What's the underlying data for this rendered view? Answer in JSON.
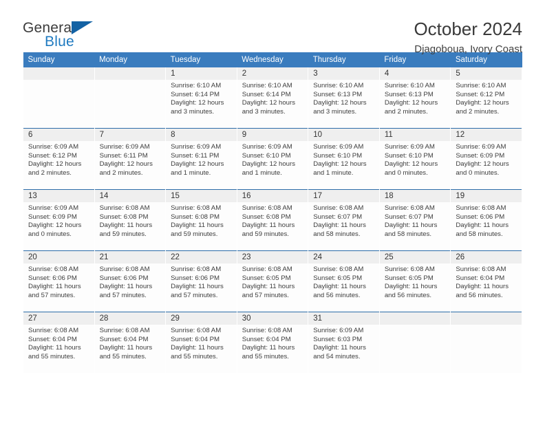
{
  "brand": {
    "name_top": "General",
    "name_bottom": "Blue",
    "triangle_icon": "triangle-icon",
    "accent_color": "#1362a4",
    "blue_text_color": "#1f7ac0"
  },
  "header": {
    "title": "October 2024",
    "subtitle": "Djagoboua, Ivory Coast"
  },
  "theme": {
    "header_row_bg": "#3a7cbe",
    "row_separator": "#2b6ca8",
    "daynum_bg": "#efefef",
    "cell_bg": "#fdfdfd"
  },
  "weekday_headers": [
    "Sunday",
    "Monday",
    "Tuesday",
    "Wednesday",
    "Thursday",
    "Friday",
    "Saturday"
  ],
  "weeks": [
    [
      {
        "day": "",
        "lines": []
      },
      {
        "day": "",
        "lines": []
      },
      {
        "day": "1",
        "lines": [
          "Sunrise: 6:10 AM",
          "Sunset: 6:14 PM",
          "Daylight: 12 hours",
          "and 3 minutes."
        ]
      },
      {
        "day": "2",
        "lines": [
          "Sunrise: 6:10 AM",
          "Sunset: 6:14 PM",
          "Daylight: 12 hours",
          "and 3 minutes."
        ]
      },
      {
        "day": "3",
        "lines": [
          "Sunrise: 6:10 AM",
          "Sunset: 6:13 PM",
          "Daylight: 12 hours",
          "and 3 minutes."
        ]
      },
      {
        "day": "4",
        "lines": [
          "Sunrise: 6:10 AM",
          "Sunset: 6:13 PM",
          "Daylight: 12 hours",
          "and 2 minutes."
        ]
      },
      {
        "day": "5",
        "lines": [
          "Sunrise: 6:10 AM",
          "Sunset: 6:12 PM",
          "Daylight: 12 hours",
          "and 2 minutes."
        ]
      }
    ],
    [
      {
        "day": "6",
        "lines": [
          "Sunrise: 6:09 AM",
          "Sunset: 6:12 PM",
          "Daylight: 12 hours",
          "and 2 minutes."
        ]
      },
      {
        "day": "7",
        "lines": [
          "Sunrise: 6:09 AM",
          "Sunset: 6:11 PM",
          "Daylight: 12 hours",
          "and 2 minutes."
        ]
      },
      {
        "day": "8",
        "lines": [
          "Sunrise: 6:09 AM",
          "Sunset: 6:11 PM",
          "Daylight: 12 hours",
          "and 1 minute."
        ]
      },
      {
        "day": "9",
        "lines": [
          "Sunrise: 6:09 AM",
          "Sunset: 6:10 PM",
          "Daylight: 12 hours",
          "and 1 minute."
        ]
      },
      {
        "day": "10",
        "lines": [
          "Sunrise: 6:09 AM",
          "Sunset: 6:10 PM",
          "Daylight: 12 hours",
          "and 1 minute."
        ]
      },
      {
        "day": "11",
        "lines": [
          "Sunrise: 6:09 AM",
          "Sunset: 6:10 PM",
          "Daylight: 12 hours",
          "and 0 minutes."
        ]
      },
      {
        "day": "12",
        "lines": [
          "Sunrise: 6:09 AM",
          "Sunset: 6:09 PM",
          "Daylight: 12 hours",
          "and 0 minutes."
        ]
      }
    ],
    [
      {
        "day": "13",
        "lines": [
          "Sunrise: 6:09 AM",
          "Sunset: 6:09 PM",
          "Daylight: 12 hours",
          "and 0 minutes."
        ]
      },
      {
        "day": "14",
        "lines": [
          "Sunrise: 6:08 AM",
          "Sunset: 6:08 PM",
          "Daylight: 11 hours",
          "and 59 minutes."
        ]
      },
      {
        "day": "15",
        "lines": [
          "Sunrise: 6:08 AM",
          "Sunset: 6:08 PM",
          "Daylight: 11 hours",
          "and 59 minutes."
        ]
      },
      {
        "day": "16",
        "lines": [
          "Sunrise: 6:08 AM",
          "Sunset: 6:08 PM",
          "Daylight: 11 hours",
          "and 59 minutes."
        ]
      },
      {
        "day": "17",
        "lines": [
          "Sunrise: 6:08 AM",
          "Sunset: 6:07 PM",
          "Daylight: 11 hours",
          "and 58 minutes."
        ]
      },
      {
        "day": "18",
        "lines": [
          "Sunrise: 6:08 AM",
          "Sunset: 6:07 PM",
          "Daylight: 11 hours",
          "and 58 minutes."
        ]
      },
      {
        "day": "19",
        "lines": [
          "Sunrise: 6:08 AM",
          "Sunset: 6:06 PM",
          "Daylight: 11 hours",
          "and 58 minutes."
        ]
      }
    ],
    [
      {
        "day": "20",
        "lines": [
          "Sunrise: 6:08 AM",
          "Sunset: 6:06 PM",
          "Daylight: 11 hours",
          "and 57 minutes."
        ]
      },
      {
        "day": "21",
        "lines": [
          "Sunrise: 6:08 AM",
          "Sunset: 6:06 PM",
          "Daylight: 11 hours",
          "and 57 minutes."
        ]
      },
      {
        "day": "22",
        "lines": [
          "Sunrise: 6:08 AM",
          "Sunset: 6:06 PM",
          "Daylight: 11 hours",
          "and 57 minutes."
        ]
      },
      {
        "day": "23",
        "lines": [
          "Sunrise: 6:08 AM",
          "Sunset: 6:05 PM",
          "Daylight: 11 hours",
          "and 57 minutes."
        ]
      },
      {
        "day": "24",
        "lines": [
          "Sunrise: 6:08 AM",
          "Sunset: 6:05 PM",
          "Daylight: 11 hours",
          "and 56 minutes."
        ]
      },
      {
        "day": "25",
        "lines": [
          "Sunrise: 6:08 AM",
          "Sunset: 6:05 PM",
          "Daylight: 11 hours",
          "and 56 minutes."
        ]
      },
      {
        "day": "26",
        "lines": [
          "Sunrise: 6:08 AM",
          "Sunset: 6:04 PM",
          "Daylight: 11 hours",
          "and 56 minutes."
        ]
      }
    ],
    [
      {
        "day": "27",
        "lines": [
          "Sunrise: 6:08 AM",
          "Sunset: 6:04 PM",
          "Daylight: 11 hours",
          "and 55 minutes."
        ]
      },
      {
        "day": "28",
        "lines": [
          "Sunrise: 6:08 AM",
          "Sunset: 6:04 PM",
          "Daylight: 11 hours",
          "and 55 minutes."
        ]
      },
      {
        "day": "29",
        "lines": [
          "Sunrise: 6:08 AM",
          "Sunset: 6:04 PM",
          "Daylight: 11 hours",
          "and 55 minutes."
        ]
      },
      {
        "day": "30",
        "lines": [
          "Sunrise: 6:08 AM",
          "Sunset: 6:04 PM",
          "Daylight: 11 hours",
          "and 55 minutes."
        ]
      },
      {
        "day": "31",
        "lines": [
          "Sunrise: 6:09 AM",
          "Sunset: 6:03 PM",
          "Daylight: 11 hours",
          "and 54 minutes."
        ]
      },
      {
        "day": "",
        "lines": []
      },
      {
        "day": "",
        "lines": []
      }
    ]
  ]
}
